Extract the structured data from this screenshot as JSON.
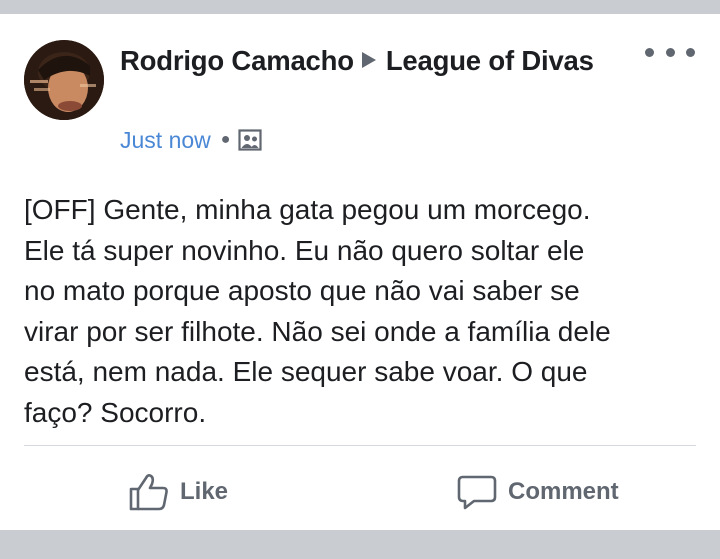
{
  "post": {
    "author": "Rodrigo Camacho",
    "group": "League of Divas",
    "timestamp": "Just now",
    "privacy_icon": "group-members-icon",
    "text": "[OFF] Gente, minha gata pegou um morcego.\nEle tá super novinho. Eu não quero soltar ele\nno mato porque aposto que não vai saber se\nvirar por ser filhote. Não sei onde a família dele\nestá, nem nada. Ele sequer sabe voar. O que\nfaço? Socorro."
  },
  "actions": {
    "like_label": "Like",
    "comment_label": "Comment"
  },
  "colors": {
    "background": "#c9ccd1",
    "card": "#ffffff",
    "text": "#1c1e21",
    "secondary": "#606770",
    "timestamp_link": "#4a88d6"
  }
}
